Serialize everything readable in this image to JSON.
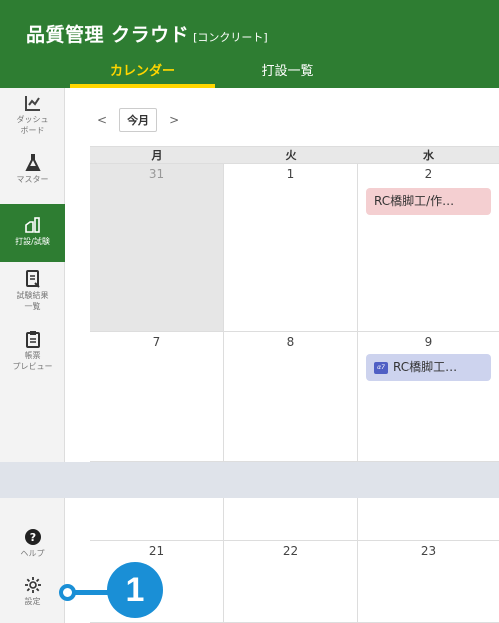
{
  "header": {
    "title": "品質管理 クラウド",
    "plan": "[コンクリート]",
    "tabs": [
      {
        "label": "カレンダー",
        "active": true
      },
      {
        "label": "打設一覧",
        "active": false
      }
    ]
  },
  "sidebar": {
    "items": [
      {
        "label": "ダッシュ\nボード",
        "icon": "dashboard-icon"
      },
      {
        "label": "マスター",
        "icon": "flask-icon"
      },
      {
        "label": "打設/試験",
        "icon": "pour-test-icon",
        "active": true
      },
      {
        "label": "試験結果\n一覧",
        "icon": "document-list-icon"
      },
      {
        "label": "帳票\nプレビュー",
        "icon": "clipboard-icon"
      }
    ],
    "bottom": [
      {
        "label": "ヘルプ",
        "icon": "help-icon"
      },
      {
        "label": "設定",
        "icon": "gear-icon"
      }
    ]
  },
  "calendar": {
    "nav": {
      "prev": "<",
      "today": "今月",
      "next": ">"
    },
    "weekdays": [
      "月",
      "火",
      "水"
    ],
    "week1": [
      {
        "day": "31",
        "muted": true
      },
      {
        "day": "1",
        "muted": false
      },
      {
        "day": "2",
        "muted": false,
        "event": "RC橋脚工/作…"
      }
    ],
    "week2": [
      {
        "day": "7"
      },
      {
        "day": "8"
      },
      {
        "day": "9",
        "event": "RC橋脚工…",
        "event_badge": "α7"
      }
    ],
    "week4": [
      {
        "day": "21"
      },
      {
        "day": "22"
      },
      {
        "day": "23"
      }
    ]
  },
  "callout": {
    "number": "1"
  },
  "colors": {
    "header_green": "#2e7d32",
    "tab_active_yellow": "#ffd600",
    "event_pink": "#f4cfd1",
    "event_blue": "#cdd3ee",
    "callout_blue": "#1a8fd6"
  }
}
